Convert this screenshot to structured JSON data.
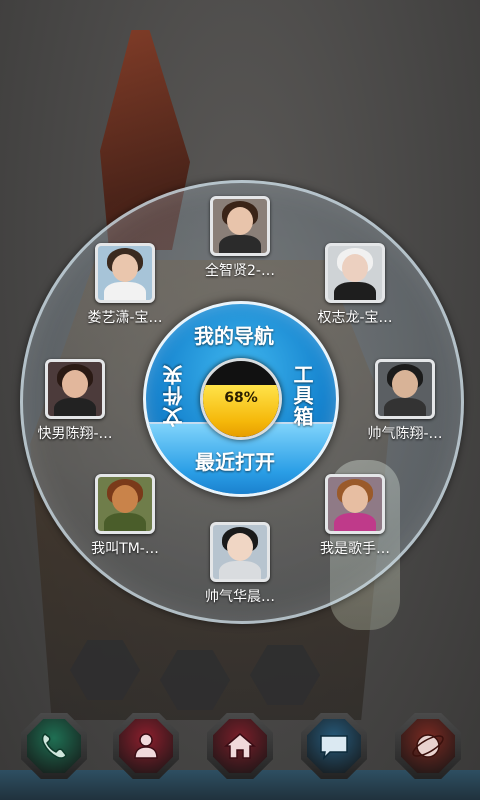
{
  "launcher": {
    "center_battery": "68%",
    "battery_level": 0.68,
    "hub_nav": "我的导航",
    "hub_tools": "工具箱",
    "hub_files": "文件夹",
    "hub_recent": "最近打开"
  },
  "contacts": [
    {
      "name": "全智贤2-…",
      "hair": "#3a2418",
      "face": "#e8c4ab",
      "body": "#2b2b2b",
      "bg": "#8a7f78"
    },
    {
      "name": "权志龙-宝…",
      "hair": "#f1f1f1",
      "face": "#ecd0c0",
      "body": "#1e1e1e",
      "bg": "#cfd3d6"
    },
    {
      "name": "帅气陈翔-…",
      "hair": "#1b1b1b",
      "face": "#d8b397",
      "body": "#333333",
      "bg": "#5b5f63"
    },
    {
      "name": "我是歌手…",
      "hair": "#9a5a2a",
      "face": "#e7bea2",
      "body": "#bf3a8a",
      "bg": "#8f7a86"
    },
    {
      "name": "帅气华晨…",
      "hair": "#1a1a1a",
      "face": "#f0d6c4",
      "body": "#d9dcdf",
      "bg": "#b7c4cf"
    },
    {
      "name": "我叫TM-…",
      "hair": "#7a3a1a",
      "face": "#c9834a",
      "body": "#4a5d2a",
      "bg": "#6f7d4a"
    },
    {
      "name": "快男陈翔-…",
      "hair": "#2a1a14",
      "face": "#e2b79c",
      "body": "#222222",
      "bg": "#4c3b3b"
    },
    {
      "name": "娄艺潇-宝…",
      "hair": "#3b2a1f",
      "face": "#eac6ad",
      "body": "#f2f2f2",
      "bg": "#a7c4d8"
    }
  ],
  "dock": [
    {
      "icon": "phone-icon",
      "color": "#1f6f53"
    },
    {
      "icon": "contacts-icon",
      "color": "#8c1f2d"
    },
    {
      "icon": "home-icon",
      "color": "#7a1f2a"
    },
    {
      "icon": "message-icon",
      "color": "#275a7a"
    },
    {
      "icon": "browser-icon",
      "color": "#7a2a22"
    }
  ]
}
